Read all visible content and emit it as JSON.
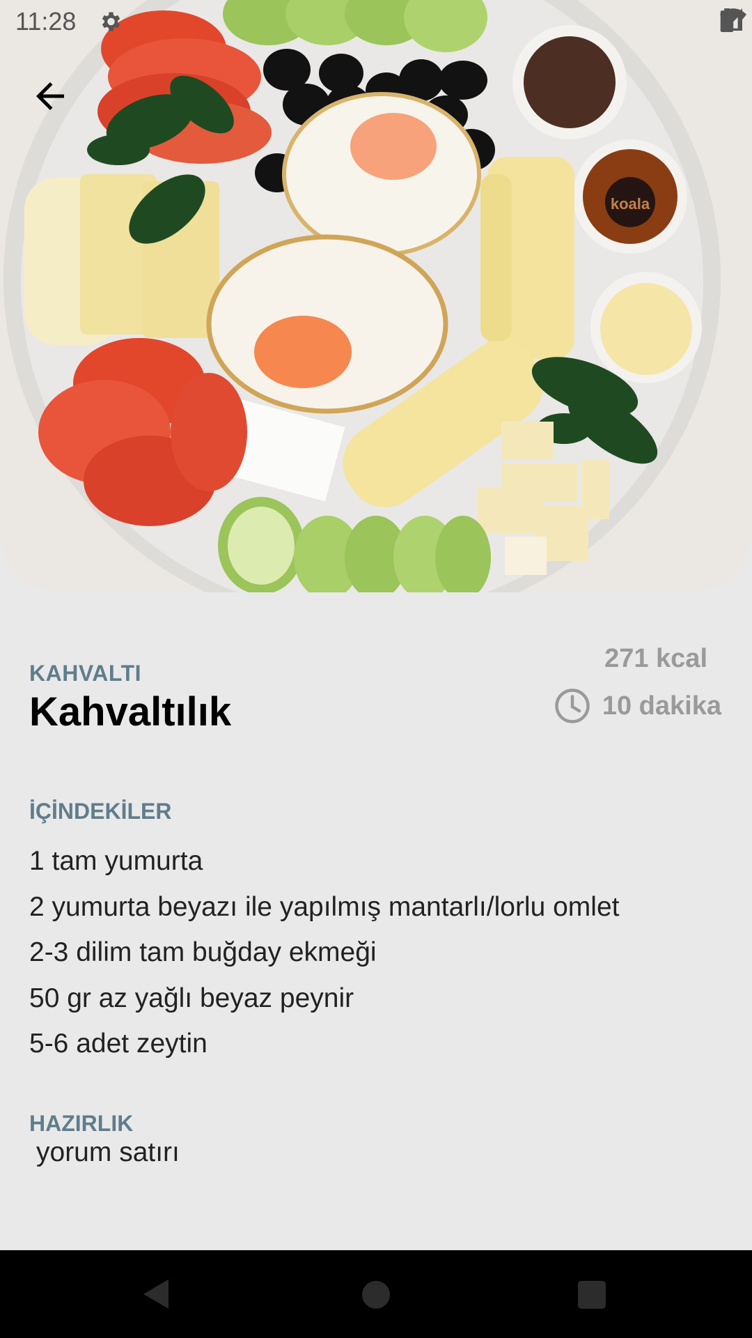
{
  "status_bar": {
    "time": "11:28",
    "icons": [
      "settings-icon",
      "wifi-icon",
      "signal-icon",
      "battery-icon"
    ]
  },
  "hero": {
    "image": "breakfast-plate-photo",
    "depicts": [
      "tomato",
      "cucumber",
      "black-olives",
      "fried-eggs",
      "cheese",
      "parsley",
      "chocolate-spread",
      "honey",
      "butter"
    ],
    "jar_label": "koala"
  },
  "recipe": {
    "category": "KAHVALTI",
    "title": "Kahvaltılık",
    "calories": "271 kcal",
    "duration": "10 dakika"
  },
  "ingredients": {
    "heading": "İÇİNDEKİLER",
    "items": [
      "1 tam yumurta",
      "2 yumurta beyazı ile yapılmış mantarlı/lorlu omlet",
      "2-3 dilim tam buğday ekmeği",
      "50 gr az yağlı beyaz peynir",
      "5-6 adet zeytin"
    ]
  },
  "preparation": {
    "heading": "HAZIRLIK",
    "text": "yorum satırı"
  },
  "navigation": {
    "icons": [
      "back-triangle-icon",
      "home-circle-icon",
      "recent-apps-square-icon"
    ]
  }
}
